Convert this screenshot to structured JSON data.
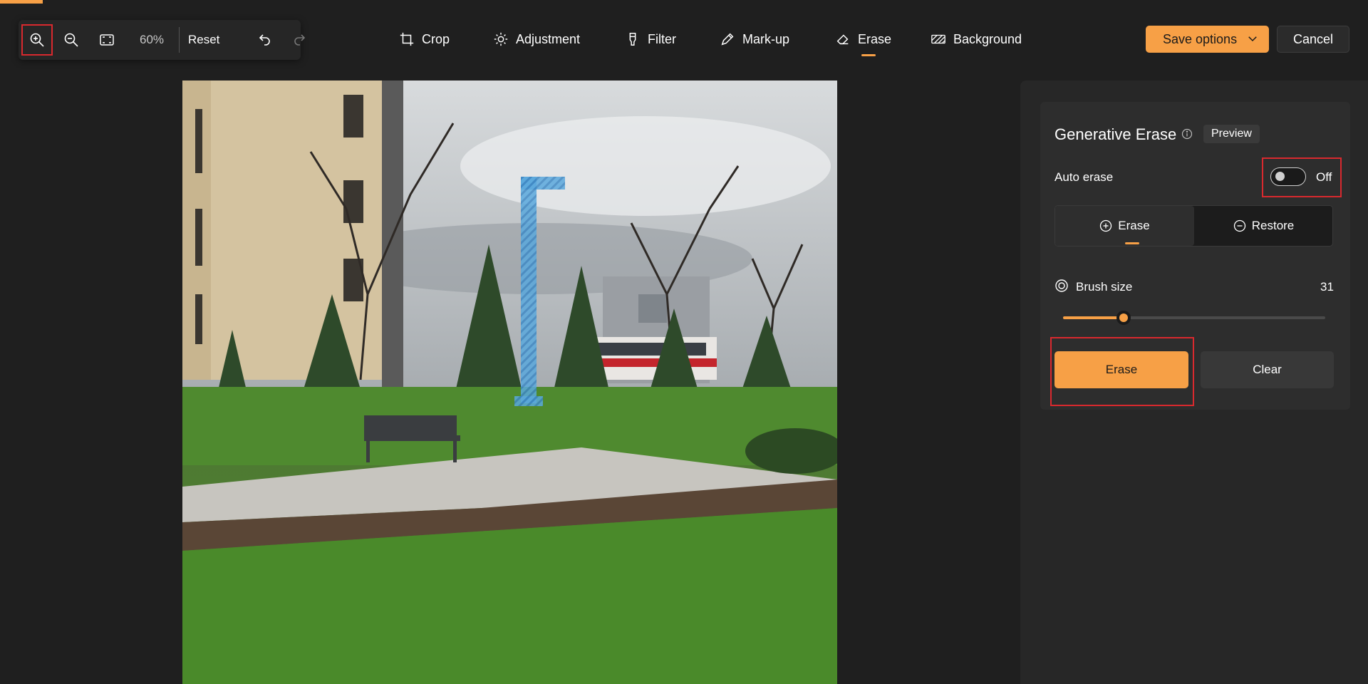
{
  "zoom_toolbar": {
    "zoom_in_icon": "zoom-in-icon",
    "zoom_out_icon": "zoom-out-icon",
    "fit_icon": "fit-to-window-icon",
    "zoom_percent": "60%",
    "reset_label": "Reset",
    "undo_icon": "undo-icon",
    "redo_icon": "redo-icon"
  },
  "nav": {
    "items": [
      {
        "label": "Crop",
        "icon": "crop-icon"
      },
      {
        "label": "Adjustment",
        "icon": "adjustment-icon"
      },
      {
        "label": "Filter",
        "icon": "filter-icon"
      },
      {
        "label": "Mark-up",
        "icon": "markup-icon"
      },
      {
        "label": "Erase",
        "icon": "erase-icon",
        "active": true
      },
      {
        "label": "Background",
        "icon": "background-icon"
      }
    ]
  },
  "actions": {
    "save_label": "Save options",
    "cancel_label": "Cancel"
  },
  "panel": {
    "title": "Generative Erase",
    "preview_badge": "Preview",
    "auto_erase_label": "Auto erase",
    "auto_erase_state": "Off",
    "mode_erase": "Erase",
    "mode_restore": "Restore",
    "brush_label": "Brush size",
    "brush_value": "31",
    "brush_fraction": 0.23,
    "erase_button": "Erase",
    "clear_button": "Clear"
  },
  "colors": {
    "accent": "#f7a046",
    "highlight": "#d9292e",
    "background": "#1f1f1f",
    "mask": "#4a9fd6"
  }
}
